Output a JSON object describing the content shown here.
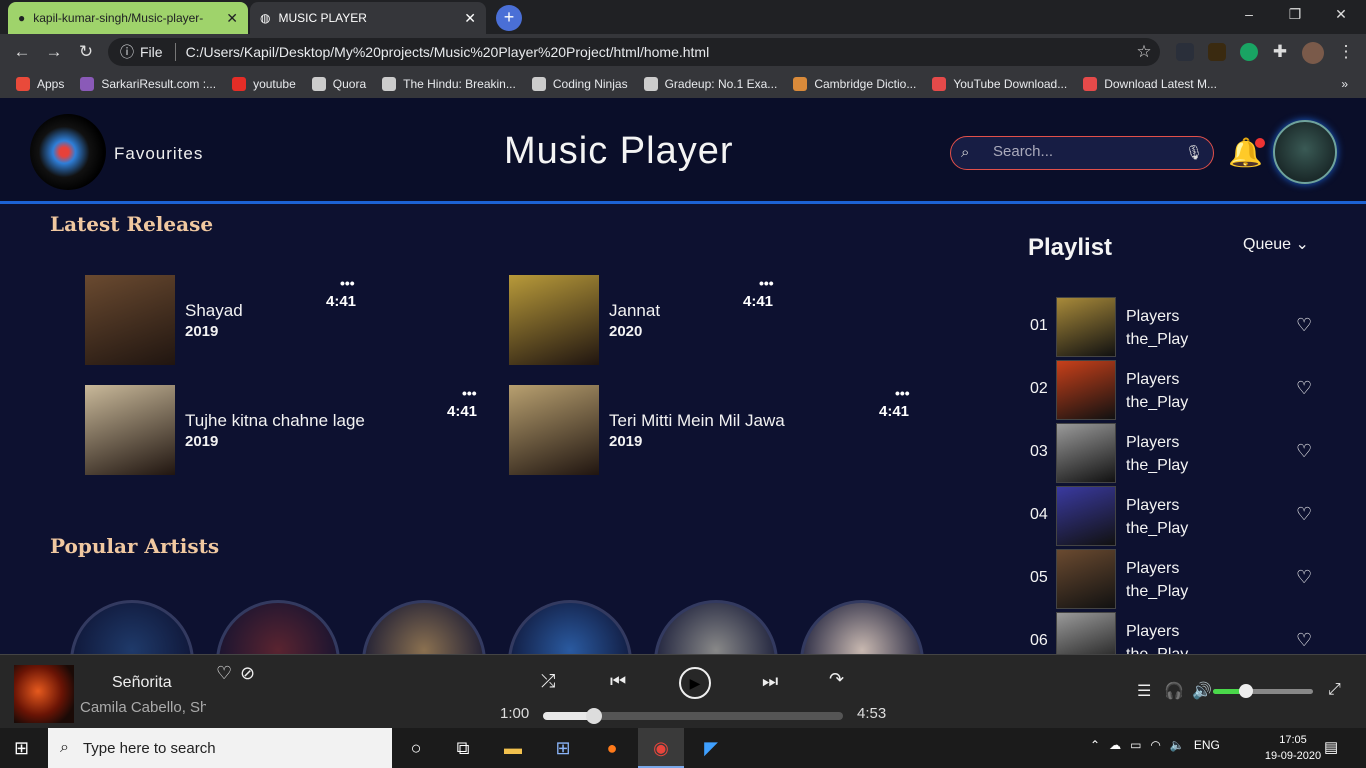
{
  "browser": {
    "tabs": [
      {
        "label": "kapil-kumar-singh/Music-player-"
      },
      {
        "label": "MUSIC PLAYER"
      }
    ],
    "window_controls": {
      "minimize": "–",
      "restore": "❐",
      "close": "✕"
    },
    "address": {
      "prefix": "File",
      "url": "C:/Users/Kapil/Desktop/My%20projects/Music%20Player%20Project/html/home.html"
    },
    "bookmarks": [
      {
        "label": "Apps",
        "color": "#e94a3a"
      },
      {
        "label": "SarkariResult.com :...",
        "color": "#8a5ab8"
      },
      {
        "label": "youtube",
        "color": "#e52d27"
      },
      {
        "label": "Quora",
        "color": "#cccccc"
      },
      {
        "label": "The Hindu: Breakin...",
        "color": "#cccccc"
      },
      {
        "label": "Coding Ninjas",
        "color": "#cccccc"
      },
      {
        "label": "Gradeup: No.1 Exa...",
        "color": "#cccccc"
      },
      {
        "label": "Cambridge Dictio...",
        "color": "#d98a3a"
      },
      {
        "label": "YouTube Download...",
        "color": "#e54a4a"
      },
      {
        "label": "Download Latest M...",
        "color": "#e54a4a"
      }
    ]
  },
  "header": {
    "favourites": "Favourites",
    "title": "Music Player",
    "search_placeholder": "Search..."
  },
  "latest_release": {
    "heading": "Latest Release",
    "items": [
      {
        "name": "Shayad",
        "year": "2019",
        "duration": "4:41",
        "dots": "•••",
        "cover_color": "#6a4a30"
      },
      {
        "name": "Jannat",
        "year": "2020",
        "duration": "4:41",
        "dots": "•••",
        "cover_color": "#b89a3a"
      },
      {
        "name": "Tujhe kitna chahne lage",
        "year": "2019",
        "duration": "4:41",
        "dots": "•••",
        "cover_color": "#c9b99a"
      },
      {
        "name": "Teri Mitti Mein Mil Jawa",
        "year": "2019",
        "duration": "4:41",
        "dots": "•••",
        "cover_color": "#b8a070"
      }
    ]
  },
  "popular_artists": {
    "heading": "Popular Artists",
    "colors": [
      "#1f3a6a",
      "#5a2430",
      "#8a7050",
      "#2a5aa0",
      "#888888",
      "#c8b8b0"
    ]
  },
  "playlist": {
    "title": "Playlist",
    "queue_label": "Queue",
    "items": [
      {
        "num": "01",
        "line1": "Players",
        "line2": "the_Play",
        "thumb": "#a88a3a"
      },
      {
        "num": "02",
        "line1": "Players",
        "line2": "the_Play",
        "thumb": "#c8401a"
      },
      {
        "num": "03",
        "line1": "Players",
        "line2": "the_Play",
        "thumb": "#9a9a9a"
      },
      {
        "num": "04",
        "line1": "Players",
        "line2": "the_Play",
        "thumb": "#3a3aa0"
      },
      {
        "num": "05",
        "line1": "Players",
        "line2": "the_Play",
        "thumb": "#6a4a30"
      },
      {
        "num": "06",
        "line1": "Players",
        "line2": "the_Play",
        "thumb": "#9a9a9a"
      }
    ]
  },
  "player": {
    "title": "Señorita",
    "artist": "Camila Cabello, Shawn Mendes",
    "elapsed": "1:00",
    "total": "4:53",
    "progress": 0.17,
    "volume": 0.33
  },
  "taskbar": {
    "search_placeholder": "Type here to search",
    "lang": "ENG",
    "time": "17:05",
    "date": "19-09-2020"
  }
}
